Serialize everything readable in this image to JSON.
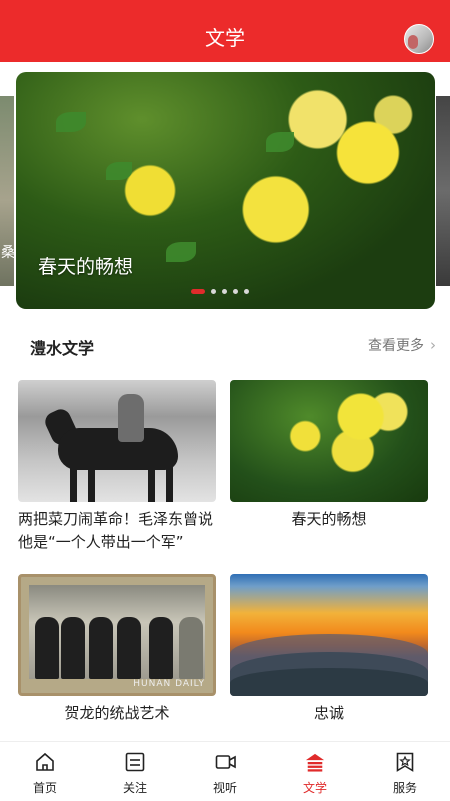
{
  "header": {
    "title": "文学"
  },
  "banner": {
    "left_peek_label": "桑",
    "caption": "春天的畅想",
    "dots": [
      true,
      false,
      false,
      false,
      false
    ]
  },
  "section": {
    "title": "澧水文学",
    "more_label": "查看更多",
    "chevron": "›"
  },
  "cards": [
    {
      "caption": "两把菜刀闹革命！毛泽东曾说他是“一个人带出一个军”",
      "image": "historic-horse-rider-photo"
    },
    {
      "caption": "春天的畅想",
      "image": "yellow-roses-photo"
    },
    {
      "caption": "贺龙的统战艺术",
      "image": "historic-group-photo"
    },
    {
      "caption": "忠诚",
      "image": "mountain-sunset-photo"
    }
  ],
  "photo_watermark": "HUNAN DAILY",
  "tabs": [
    {
      "label": "首页",
      "icon": "home-icon",
      "active": false
    },
    {
      "label": "关注",
      "icon": "follow-icon",
      "active": false
    },
    {
      "label": "视听",
      "icon": "video-icon",
      "active": false
    },
    {
      "label": "文学",
      "icon": "literature-icon",
      "active": true
    },
    {
      "label": "服务",
      "icon": "service-icon",
      "active": false
    }
  ],
  "colors": {
    "brand_red": "#ec2b2b",
    "active_red": "#e02b2b"
  }
}
